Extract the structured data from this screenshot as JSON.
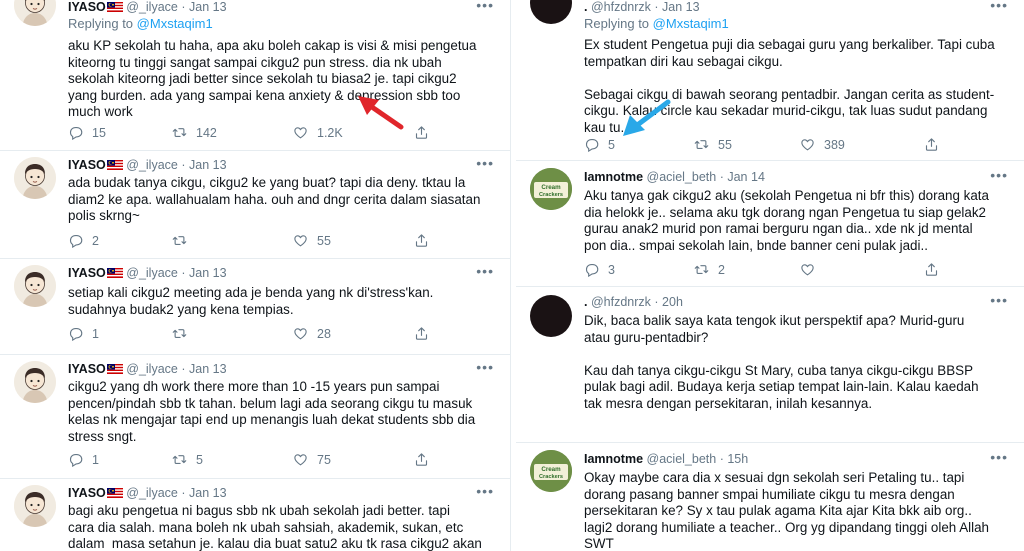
{
  "left_column": {
    "tweets": [
      {
        "name": "IYASO",
        "handle": "@_ilyace",
        "time": "Jan 13",
        "replying_prefix": "Replying to",
        "replying_to": "@Mxstaqim1",
        "text": "aku KP sekolah tu haha, apa aku boleh cakap is visi & misi pengetua\nkiteorng tu tinggi sangat sampai cikgu2 pun stress. dia nk ubah\nsekolah kiteorng jadi better since sekolah tu biasa2 je. tapi cikgu2\nyang burden. ada yang sampai kena anxiety & depression sbb too\nmuch work",
        "replies": "15",
        "retweets": "142",
        "likes": "1.2K"
      },
      {
        "name": "IYASO",
        "handle": "@_ilyace",
        "time": "Jan 13",
        "text": "ada budak tanya cikgu, cikgu2 ke yang buat? tapi dia deny. tktau la\ndiam2 ke apa. wallahualam haha. ouh and dngr cerita dalam siasatan\npolis skrng~",
        "replies": "2",
        "retweets": "",
        "likes": "55"
      },
      {
        "name": "IYASO",
        "handle": "@_ilyace",
        "time": "Jan 13",
        "text": "setiap kali cikgu2 meeting ada je benda yang nk di'stress'kan.\nsudahnya budak2 yang kena tempias.",
        "replies": "1",
        "retweets": "",
        "likes": "28"
      },
      {
        "name": "IYASO",
        "handle": "@_ilyace",
        "time": "Jan 13",
        "text": "cikgu2 yang dh work there more than 10 -15 years pun sampai\npencen/pindah sbb tk tahan. belum lagi ada seorang cikgu tu masuk\nkelas nk mengajar tapi end up menangis luah dekat students sbb dia\nstress sngt.",
        "replies": "1",
        "retweets": "5",
        "likes": "75"
      },
      {
        "name": "IYASO",
        "handle": "@_ilyace",
        "time": "Jan 13",
        "text": "bagi aku pengetua ni bagus sbb nk ubah sekolah jadi better. tapi\ncara dia salah. mana boleh nk ubah sahsiah, akademik, sukan, etc\ndalam  masa setahun je. kalau dia buat satu2 aku tk rasa cikgu2 akan",
        "replies": "",
        "retweets": "",
        "likes": ""
      }
    ]
  },
  "right_column": {
    "tweets": [
      {
        "name": ".",
        "handle": "@hfzdnrzk",
        "time": "Jan 13",
        "replying_prefix": "Replying to",
        "replying_to": "@Mxstaqim1",
        "text": "Ex student Pengetua puji dia sebagai guru yang berkaliber. Tapi cuba\ntempatkan diri kau sebagai cikgu.\n\nSebagai cikgu di bawah seorang pentadbir. Jangan cerita as student-\ncikgu. Kalau circle kau sekadar murid-cikgu, tak luas sudut pandang\nkau tu.",
        "replies": "5",
        "retweets": "55",
        "likes": "389"
      },
      {
        "name": "Iamnotme",
        "handle": "@aciel_beth",
        "time": "Jan 14",
        "avatar_text": "Cream Crackers",
        "text": "Aku tanya gak cikgu2 aku (sekolah Pengetua ni bfr this) dorang kata\ndia helokk je.. selama aku tgk dorang ngan Pengetua tu siap gelak2\ngurau anak2 murid pon ramai berguru ngan dia.. xde nk jd mental\npon dia.. smpai sekolah lain, bnde banner ceni pulak jadi..",
        "replies": "3",
        "retweets": "2",
        "likes": ""
      },
      {
        "name": ".",
        "handle": "@hfzdnrzk",
        "time": "20h",
        "text": "Dik, baca balik saya kata tengok ikut perspektif apa? Murid-guru\natau guru-pentadbir?\n\nKau dah tanya cikgu-cikgu St Mary, cuba tanya cikgu-cikgu BBSP\npulak bagi adil. Budaya kerja setiap tempat lain-lain. Kalau kaedah\ntak mesra dengan persekitaran, inilah kesannya.",
        "replies": "",
        "retweets": "",
        "likes": ""
      },
      {
        "name": "Iamnotme",
        "handle": "@aciel_beth",
        "time": "15h",
        "avatar_text": "Cream Crackers",
        "text": "Okay maybe cara dia x sesuai dgn sekolah seri Petaling tu.. tapi\ndorang pasang banner smpai humiliate cikgu tu mesra dengan\npersekitaran ke? Sy x tau pulak agama Kita ajar Kita bkk aib org..\nlagi2 dorang humiliate a teacher.. Org yg dipandang tinggi oleh Allah\nSWT",
        "replies": "",
        "retweets": "",
        "likes": ""
      }
    ]
  },
  "colors": {
    "text": "#0f1419",
    "muted": "#657786",
    "link": "#1da1f2",
    "red_arrow": "#e0262b",
    "blue_arrow": "#29a8e8"
  },
  "icons": [
    "reply-icon",
    "retweet-icon",
    "like-icon",
    "share-icon",
    "more-icon",
    "malaysia-flag-icon",
    "arrow-icon"
  ]
}
